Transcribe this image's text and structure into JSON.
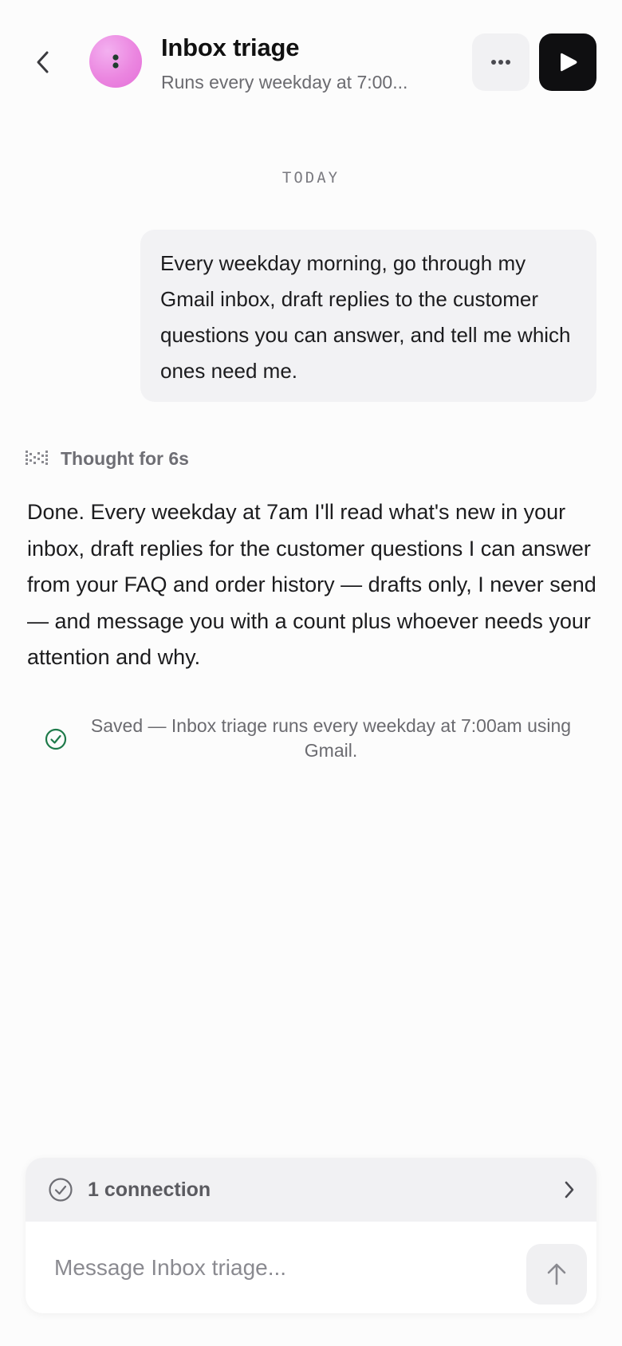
{
  "header": {
    "title": "Inbox triage",
    "subtitle": "Runs every weekday at 7:00...",
    "back_icon": "chevron-left-icon",
    "more_icon": "ellipsis-icon",
    "play_icon": "play-icon",
    "avatar_color": "#eb86e0"
  },
  "day_separator": "TODAY",
  "messages": {
    "user": "Every weekday morning, go through my Gmail inbox, draft replies to the customer questions you can answer, and tell me which ones need me.",
    "thought_label": "Thought for 6s",
    "assistant": "Done. Every weekday at 7am I'll read what's new in your inbox, draft replies for the customer questions I can answer from your FAQ and order history — drafts only, I never send — and message you with a count plus whoever needs your attention and why.",
    "saved_notice": "Saved — Inbox triage runs every weekday at 7:00am using Gmail.",
    "saved_color": "#1e7a4a"
  },
  "composer": {
    "connections_label": "1 connection",
    "placeholder": "Message Inbox triage...",
    "send_icon": "arrow-up-icon"
  }
}
